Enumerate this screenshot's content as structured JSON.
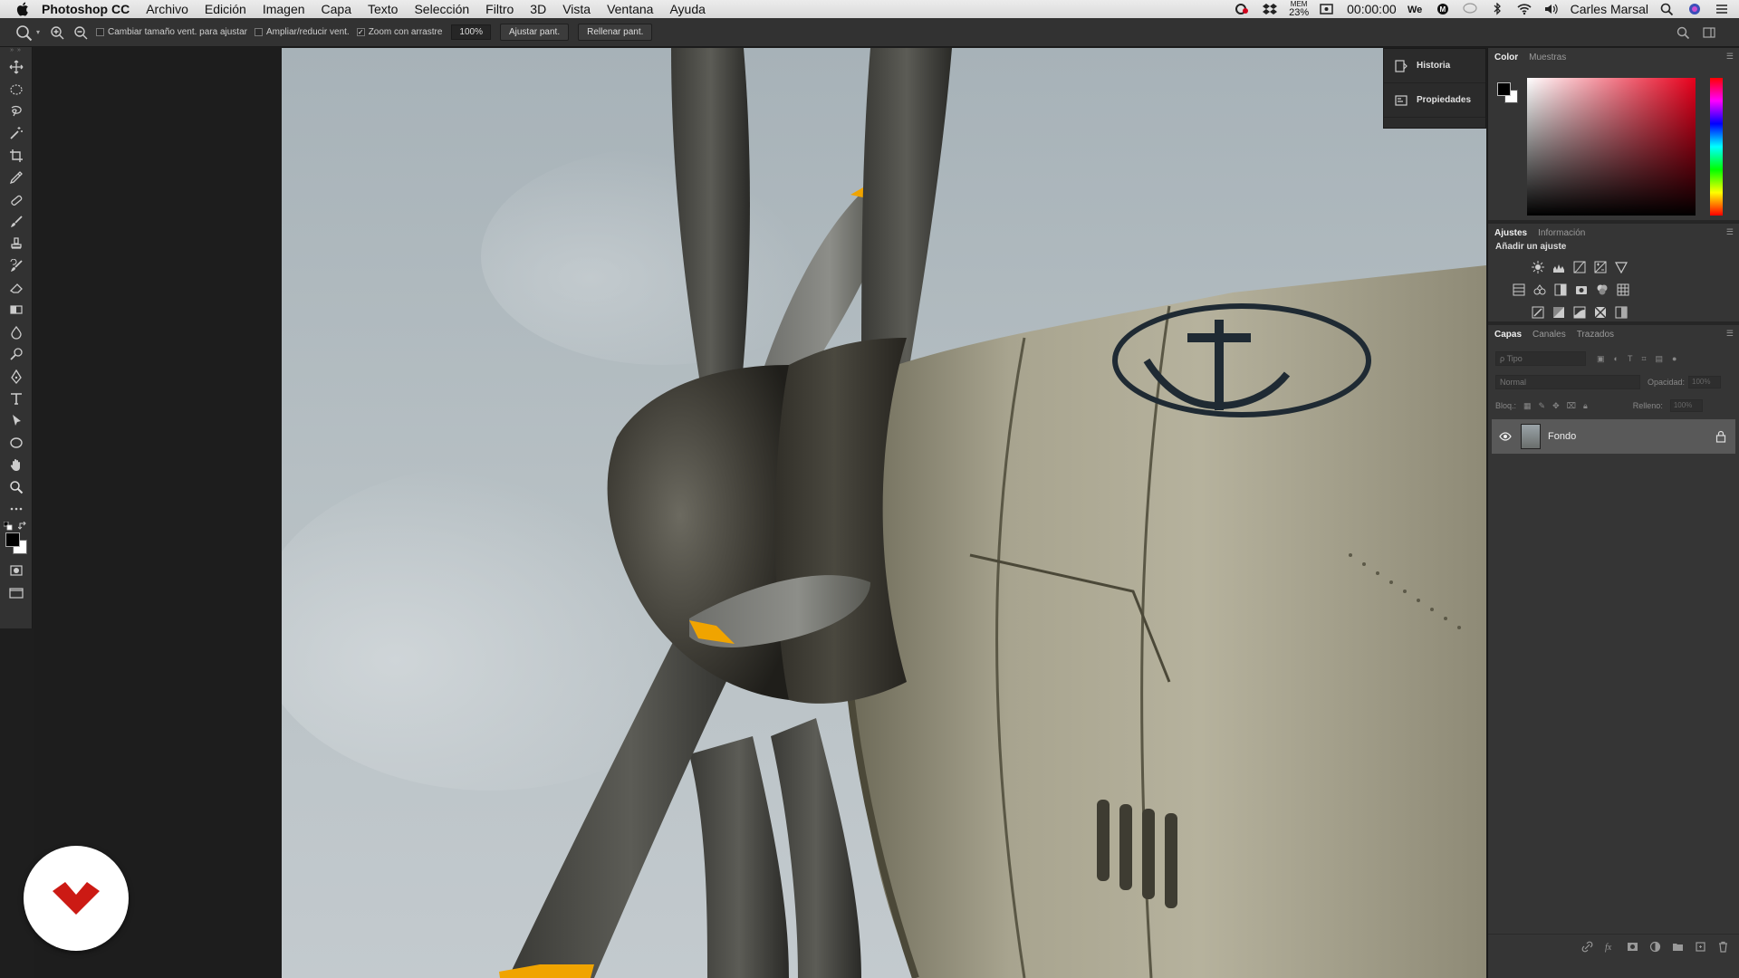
{
  "menubar": {
    "app_name": "Photoshop CC",
    "items": [
      "Archivo",
      "Edición",
      "Imagen",
      "Capa",
      "Texto",
      "Selección",
      "Filtro",
      "3D",
      "Vista",
      "Ventana",
      "Ayuda"
    ],
    "mem_label": "MEM",
    "mem_value": "23%",
    "clock": "00:00:00",
    "user": "Carles Marsal"
  },
  "options_bar": {
    "resize_windows_label": "Cambiar tamaño vent. para ajustar",
    "resize_windows_checked": false,
    "zoom_all_windows_label": "Ampliar/reducir vent.",
    "zoom_all_windows_checked": false,
    "scrubby_zoom_label": "Zoom con arrastre",
    "scrubby_zoom_checked": true,
    "zoom_value": "100%",
    "fit_screen_label": "Ajustar pant.",
    "fill_screen_label": "Rellenar pant."
  },
  "toolbar": {
    "tools": [
      "move-tool-icon",
      "ellipse-marquee-icon",
      "lasso-icon",
      "magic-wand-icon",
      "crop-icon",
      "eyedropper-icon",
      "healing-brush-icon",
      "brush-icon",
      "clone-stamp-icon",
      "history-brush-icon",
      "eraser-icon",
      "gradient-icon",
      "blur-icon",
      "dodge-icon",
      "pen-icon",
      "type-icon",
      "path-selection-icon",
      "ellipse-shape-icon",
      "hand-icon",
      "zoom-icon",
      "more-tools-icon"
    ],
    "foreground_color": "#000000",
    "background_color": "#ffffff"
  },
  "dock": {
    "items": [
      "Historia",
      "Propiedades"
    ]
  },
  "color_panel": {
    "tabs": [
      "Color",
      "Muestras"
    ],
    "active_tab": "Color",
    "hue_color": "#e8001c"
  },
  "adjustments_panel": {
    "tabs": [
      "Ajustes",
      "Información"
    ],
    "active_tab": "Ajustes",
    "title": "Añadir un ajuste"
  },
  "layers_panel": {
    "tabs": [
      "Capas",
      "Canales",
      "Trazados"
    ],
    "active_tab": "Capas",
    "search_placeholder": "ρ Tipo",
    "blend_mode": "Normal",
    "opacity_label": "Opacidad:",
    "opacity_value": "100%",
    "lock_label": "Bloq.:",
    "fill_label": "Relleno:",
    "fill_value": "100%",
    "layers": [
      {
        "name": "Fondo",
        "visible": true,
        "locked": true
      }
    ]
  }
}
